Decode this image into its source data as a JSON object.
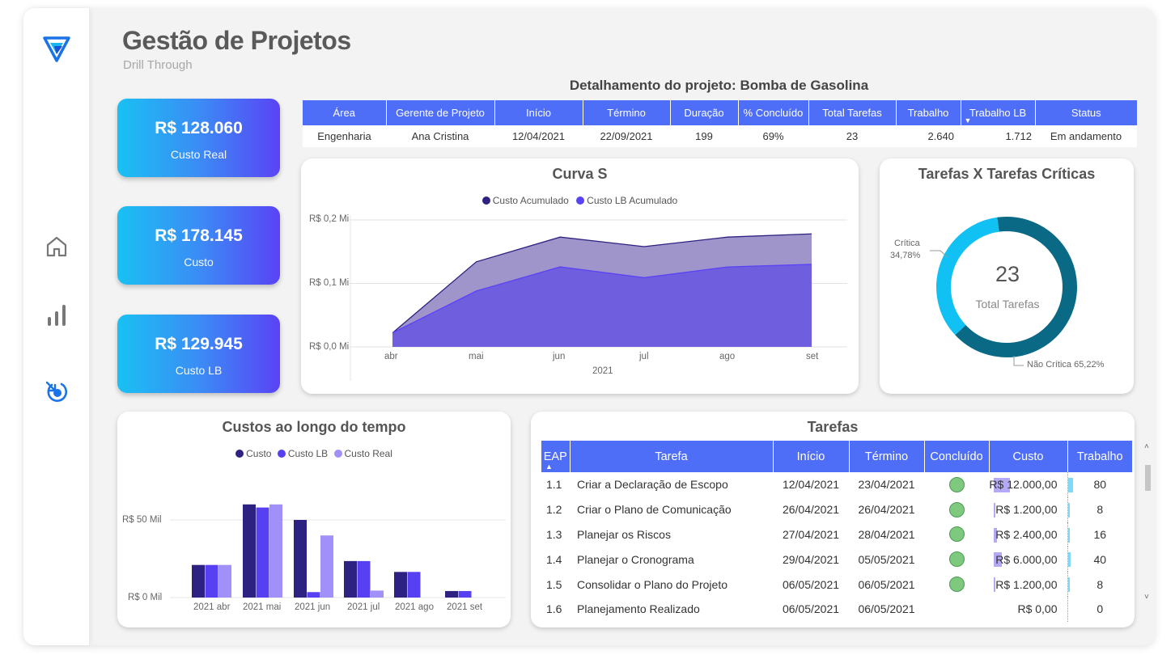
{
  "page": {
    "title": "Gestão de Projetos",
    "subtitle": "Drill Through"
  },
  "sidebar": {
    "items": [
      "logo-icon",
      "home-icon",
      "bar-chart-icon",
      "drill-through-icon"
    ]
  },
  "kpis": [
    {
      "value": "R$ 128.060",
      "label": "Custo Real"
    },
    {
      "value": "R$ 178.145",
      "label": "Custo"
    },
    {
      "value": "R$ 129.945",
      "label": "Custo LB"
    }
  ],
  "project": {
    "title": "Detalhamento do projeto: Bomba de Gasolina",
    "headers": [
      "Área",
      "Gerente de Projeto",
      "Início",
      "Término",
      "Duração",
      "% Concluído",
      "Total Tarefas",
      "Trabalho",
      "Trabalho LB",
      "Status"
    ],
    "row": [
      "Engenharia",
      "Ana Cristina",
      "12/04/2021",
      "22/09/2021",
      "199",
      "69%",
      "23",
      "2.640",
      "1.712",
      "Em andamento"
    ]
  },
  "curva_s": {
    "title": "Curva S",
    "legend": [
      "Custo Acumulado",
      "Custo LB Acumulado"
    ],
    "y_ticks": [
      "R$ 0,2 Mi",
      "R$ 0,1 Mi",
      "R$ 0,0 Mi"
    ],
    "x_ticks": [
      "abr",
      "mai",
      "jun",
      "jul",
      "ago",
      "set"
    ],
    "x_title": "2021"
  },
  "donut": {
    "title": "Tarefas X Tarefas Críticas",
    "center_value": "23",
    "center_label": "Total Tarefas",
    "critica_label": "Crítica",
    "critica_pct": "34,78%",
    "nao_critica_label": "Não Crítica 65,22%"
  },
  "custos": {
    "title": "Custos ao longo do tempo",
    "legend": [
      "Custo",
      "Custo LB",
      "Custo Real"
    ],
    "y_ticks": [
      "R$ 50 Mil",
      "R$ 0 Mil"
    ],
    "x_ticks": [
      "2021 abr",
      "2021 mai",
      "2021 jun",
      "2021 jul",
      "2021 ago",
      "2021 set"
    ]
  },
  "tarefas": {
    "title": "Tarefas",
    "headers": [
      "EAP",
      "Tarefa",
      "Início",
      "Término",
      "Concluído",
      "Custo",
      "Trabalho"
    ],
    "rows": [
      [
        "1.1",
        "Criar a Declaração de Escopo",
        "12/04/2021",
        "23/04/2021",
        "R$ 12.000,00",
        "80"
      ],
      [
        "1.2",
        "Criar o Plano de Comunicação",
        "26/04/2021",
        "26/04/2021",
        "R$ 1.200,00",
        "8"
      ],
      [
        "1.3",
        "Planejar os Riscos",
        "27/04/2021",
        "28/04/2021",
        "R$ 2.400,00",
        "16"
      ],
      [
        "1.4",
        "Planejar o Cronograma",
        "29/04/2021",
        "05/05/2021",
        "R$ 6.000,00",
        "40"
      ],
      [
        "1.5",
        "Consolidar o Plano do Projeto",
        "06/05/2021",
        "06/05/2021",
        "R$ 1.200,00",
        "8"
      ],
      [
        "1.6",
        "Planejamento Realizado",
        "06/05/2021",
        "06/05/2021",
        "R$ 0,00",
        "0"
      ]
    ],
    "done": [
      true,
      true,
      true,
      true,
      true,
      false
    ],
    "cost_fraction": [
      1.0,
      0.1,
      0.2,
      0.5,
      0.1,
      0.0
    ],
    "work_fraction": [
      1.0,
      0.1,
      0.2,
      0.5,
      0.1,
      0.0
    ]
  },
  "chart_data": [
    {
      "type": "area",
      "title": "Curva S",
      "x": [
        "abr",
        "mai",
        "jun",
        "jul",
        "ago",
        "set"
      ],
      "xlabel": "2021",
      "ylim": [
        0,
        0.2
      ],
      "series": [
        {
          "name": "Custo Acumulado",
          "values": [
            0.022,
            0.134,
            0.173,
            0.158,
            0.173,
            0.178
          ]
        },
        {
          "name": "Custo LB Acumulado",
          "values": [
            0.022,
            0.088,
            0.126,
            0.109,
            0.126,
            0.13
          ]
        }
      ],
      "colors": [
        "#9a8fc7",
        "#6a5adf"
      ]
    },
    {
      "type": "pie",
      "title": "Tarefas X Tarefas Críticas",
      "categories": [
        "Crítica",
        "Não Crítica"
      ],
      "values": [
        34.78,
        65.22
      ],
      "colors": [
        "#12c1f3",
        "#0a6a86"
      ]
    },
    {
      "type": "bar",
      "title": "Custos ao longo do tempo",
      "categories": [
        "2021 abr",
        "2021 mai",
        "2021 jun",
        "2021 jul",
        "2021 ago",
        "2021 set"
      ],
      "ylim": [
        0,
        85
      ],
      "series": [
        {
          "name": "Custo",
          "values": [
            21,
            60,
            50,
            23.5,
            16.5,
            4.2
          ],
          "color": "#2d2281"
        },
        {
          "name": "Custo LB",
          "values": [
            21,
            58,
            3.5,
            23.5,
            16.5,
            4.2
          ],
          "color": "#5640f2"
        },
        {
          "name": "Custo Real",
          "values": [
            21,
            60,
            40,
            4.5,
            0,
            0
          ],
          "color": "#a190f7"
        }
      ]
    }
  ]
}
